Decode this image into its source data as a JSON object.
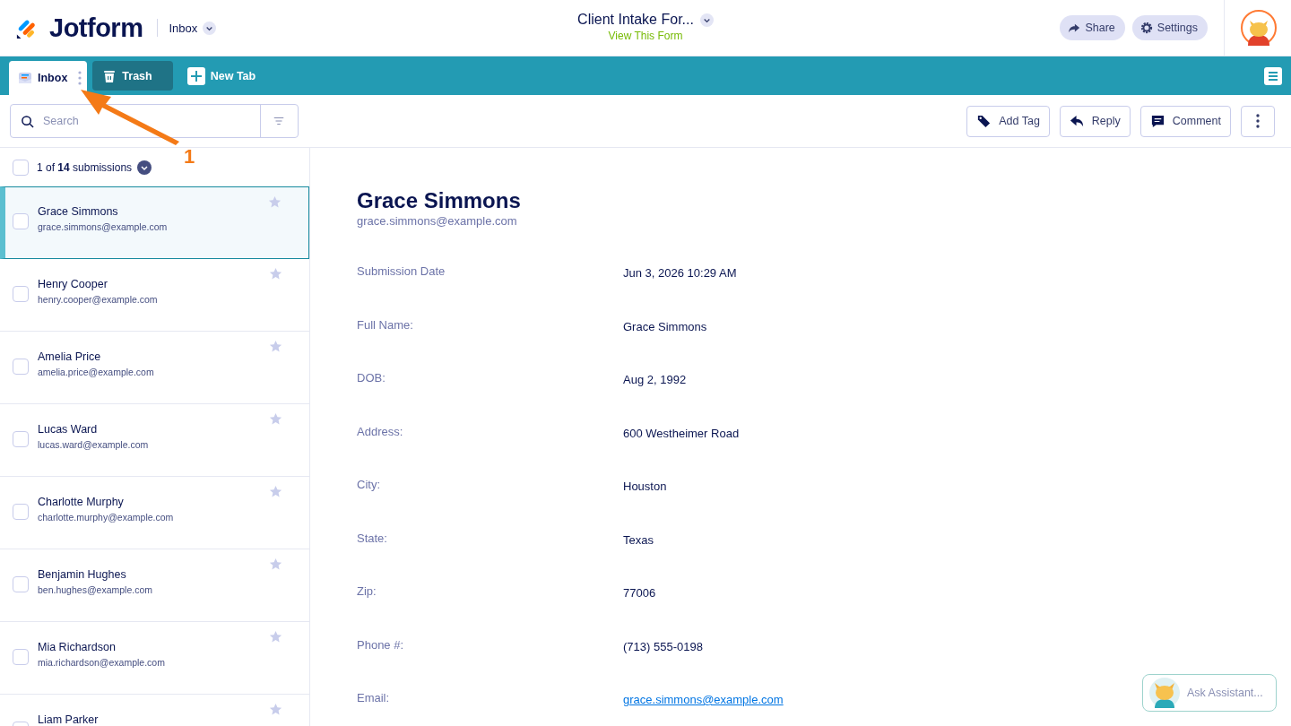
{
  "header": {
    "brand": "Jotform",
    "section": "Inbox",
    "form_title": "Client Intake For...",
    "form_link": "View This Form",
    "buttons": [
      {
        "label": "Share",
        "kind": "share"
      },
      {
        "label": "Settings",
        "kind": "settings"
      }
    ]
  },
  "tabs": [
    {
      "label": "Inbox",
      "kind": "inbox",
      "selected": true
    },
    {
      "label": "Trash",
      "kind": "trash",
      "selected": false
    },
    {
      "label": "New Tab",
      "kind": "new",
      "selected": false
    }
  ],
  "search": {
    "placeholder": "Search"
  },
  "actions": [
    {
      "label": "Add Tag",
      "kind": "tag"
    },
    {
      "label": "Reply",
      "kind": "reply"
    },
    {
      "label": "Comment",
      "kind": "comment"
    }
  ],
  "list_header": {
    "count": "1 of **14** submissions",
    "checked": false
  },
  "submissions": [
    {
      "name": "Grace Simmons",
      "email": "grace.simmons@example.com",
      "selected": true,
      "checked": false,
      "starred": false
    },
    {
      "name": "Henry Cooper",
      "email": "henry.cooper@example.com",
      "selected": false,
      "checked": false,
      "starred": false
    },
    {
      "name": "Amelia Price",
      "email": "amelia.price@example.com",
      "selected": false,
      "checked": false,
      "starred": false
    },
    {
      "name": "Lucas Ward",
      "email": "lucas.ward@example.com",
      "selected": false,
      "checked": false,
      "starred": false
    },
    {
      "name": "Charlotte Murphy",
      "email": "charlotte.murphy@example.com",
      "selected": false,
      "checked": false,
      "starred": false
    },
    {
      "name": "Benjamin Hughes",
      "email": "ben.hughes@example.com",
      "selected": false,
      "checked": false,
      "starred": false
    },
    {
      "name": "Mia Richardson",
      "email": "mia.richardson@example.com",
      "selected": false,
      "checked": false,
      "starred": false
    },
    {
      "name": "Liam Parker",
      "selected": false,
      "checked": false,
      "starred": false
    }
  ],
  "detail": {
    "name": "Grace Simmons",
    "email": "grace.simmons@example.com",
    "fields": [
      {
        "label": "Submission Date",
        "value": "Jun 3, 2026 10:29 AM"
      },
      {
        "label": "Full Name:",
        "value": "Grace Simmons"
      },
      {
        "label": "DOB:",
        "value": "Aug 2, 1992"
      },
      {
        "label": "Address:",
        "value": "600 Westheimer Road"
      },
      {
        "label": "City:",
        "value": "Houston"
      },
      {
        "label": "State:",
        "value": "Texas"
      },
      {
        "label": "Zip:",
        "value": "77006"
      },
      {
        "label": "Phone #:",
        "value": "(713) 555-0198"
      },
      {
        "label": "Email:",
        "value": "grace.simmons@example.com",
        "kind": "link"
      }
    ]
  },
  "assistant": {
    "label": "Ask Assistant..."
  },
  "annotation": {
    "label": "1"
  }
}
